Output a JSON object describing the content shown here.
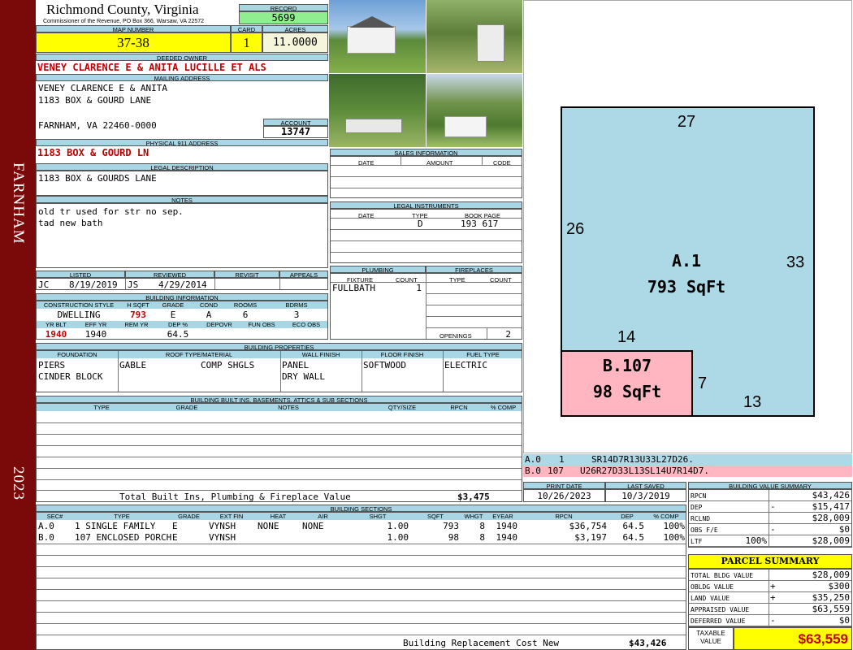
{
  "sidebar": {
    "district": "FARNHAM",
    "year": "2023"
  },
  "header": {
    "county": "Richmond County, Virginia",
    "commissioner": "Commissioner of the Revenue, PO Box 366, Warsaw, VA 22572",
    "record_label": "RECORD",
    "record": "5699",
    "map_label": "MAP NUMBER",
    "map_number": "37-38",
    "card_label": "CARD",
    "card": "1",
    "acres_label": "ACRES",
    "acres": "11.0000"
  },
  "owner": {
    "deeded_label": "DEEDED OWNER",
    "deeded": "VENEY CLARENCE E & ANITA LUCILLE ET ALS",
    "mailing_label": "MAILING ADDRESS",
    "mail1": "VENEY CLARENCE E & ANITA",
    "mail2": "1183 BOX & GOURD LANE",
    "mail3": "FARNHAM, VA 22460-0000",
    "account_label": "ACCOUNT",
    "account": "13747",
    "physical_label": "PHYSICAL 911 ADDRESS",
    "physical": "1183 BOX & GOURD LN",
    "legal_label": "LEGAL DESCRIPTION",
    "legal": "1183 BOX & GOURDS LANE",
    "notes_label": "NOTES",
    "note1": "old tr used for str no sep.",
    "note2": "tad new bath"
  },
  "sales": {
    "title": "SALES INFORMATION",
    "h_date": "DATE",
    "h_amount": "AMOUNT",
    "h_code": "CODE"
  },
  "instruments": {
    "title": "LEGAL INSTRUMENTS",
    "h_date": "DATE",
    "h_type": "TYPE",
    "h_book": "BOOK PAGE",
    "type": "D",
    "book": "193 617"
  },
  "listing": {
    "listed_label": "LISTED",
    "reviewed_label": "REVIEWED",
    "revisit_label": "REVISIT",
    "appeals_label": "APPEALS",
    "listed_by": "JC",
    "listed_date": "8/19/2019",
    "reviewed_by": "JS",
    "reviewed_date": "4/29/2014"
  },
  "plumbing": {
    "title": "PLUMBING",
    "h_fixture": "FIXTURE",
    "h_count": "COUNT",
    "fixture": "FULLBATH",
    "count": "1"
  },
  "fireplaces": {
    "title": "FIREPLACES",
    "h_type": "TYPE",
    "h_count": "COUNT",
    "openings_label": "OPENINGS",
    "openings": "2"
  },
  "building": {
    "title": "BUILDING INFORMATION",
    "h_style": "CONSTRUCTION STYLE",
    "h_hsqft": "H SQFT",
    "h_grade": "GRADE",
    "h_cond": "COND",
    "h_rooms": "ROOMS",
    "h_bdrms": "BDRMS",
    "style": "DWELLING",
    "hsqft": "793",
    "grade": "E",
    "cond": "A",
    "rooms": "6",
    "bdrms": "3",
    "h_yrblt": "YR BLT",
    "h_effyr": "EFF YR",
    "h_remyr": "REM YR",
    "h_dep": "DEP %",
    "h_depovr": "DEPOVR",
    "h_funobs": "FUN OBS",
    "h_ecoobs": "ECO OBS",
    "yrblt": "1940",
    "effyr": "1940",
    "dep": "64.5"
  },
  "properties": {
    "title": "BUILDING PROPERTIES",
    "h_found": "FOUNDATION",
    "h_roof": "ROOF TYPE/MATERIAL",
    "h_wall": "WALL FINISH",
    "h_floor": "FLOOR FINISH",
    "h_fuel": "FUEL TYPE",
    "found1": "PIERS",
    "found2": "CINDER BLOCK",
    "roof_type": "GABLE",
    "roof_mat": "COMP SHGLS",
    "wall1": "PANEL",
    "wall2": "DRY WALL",
    "floor": "SOFTWOOD",
    "fuel": "ELECTRIC"
  },
  "builtins": {
    "title": "BUILDING BUILT INS, BASEMENTS, ATTICS & SUB SECTIONS",
    "h_type": "TYPE",
    "h_grade": "GRADE",
    "h_notes": "NOTES",
    "h_qty": "QTY/SIZE",
    "h_rpcn": "RPCN",
    "h_comp": "% COMP",
    "total_label": "Total Built Ins, Plumbing & Fireplace Value",
    "total": "$3,475"
  },
  "sketch": {
    "a_label": "A.1",
    "a_area": "793 SqFt",
    "b_label": "B.107",
    "b_area": "98 SqFt",
    "d_top": "27",
    "d_left": "26",
    "d_right": "33",
    "d_mid": "14",
    "d_7": "7",
    "d_13": "13",
    "fill_a": "#add8e6",
    "fill_b": "#ffb6c1",
    "legend": [
      {
        "id": "A.0",
        "code": "1",
        "path": "SR14D7R13U33L27D26."
      },
      {
        "id": "B.0",
        "code": "107",
        "path": "U26R27D33L13SL14U7R14D7."
      }
    ]
  },
  "dates": {
    "print_label": "PRINT DATE",
    "print": "10/26/2023",
    "saved_label": "LAST SAVED",
    "saved": "10/3/2019"
  },
  "sections": {
    "title": "BUILDING SECTIONS",
    "headers": [
      "SEC#",
      "TYPE",
      "GRADE",
      "EXT FIN",
      "HEAT",
      "AIR",
      "SHGT",
      "SQFT",
      "WHGT",
      "EYEAR",
      "RPCN",
      "DEP",
      "% COMP"
    ],
    "rows": [
      [
        "A.0",
        "1 SINGLE FAMILY",
        "E",
        "VYNSH",
        "NONE",
        "NONE",
        "1.00",
        "793",
        "8",
        "1940",
        "$36,754",
        "64.5",
        "100%"
      ],
      [
        "B.0",
        "107 ENCLOSED PORCH",
        "E",
        "VYNSH",
        "",
        "",
        "1.00",
        "98",
        "8",
        "1940",
        "$3,197",
        "64.5",
        "100%"
      ]
    ],
    "replacement_label": "Building Replacement Cost New",
    "replacement": "$43,426"
  },
  "bvs": {
    "title": "BUILDING VALUE SUMMARY",
    "rows": [
      {
        "label": "RPCN",
        "sign": "",
        "value": "$43,426"
      },
      {
        "label": "DEP",
        "sign": "-",
        "value": "$15,417"
      },
      {
        "label": "RCLND",
        "sign": "",
        "value": "$28,009"
      },
      {
        "label": "OBS F/E",
        "sign": "-",
        "value": "$0"
      },
      {
        "label": "LTF",
        "sign": "100%",
        "value": "$28,009"
      }
    ]
  },
  "parcel": {
    "title": "PARCEL SUMMARY",
    "rows": [
      {
        "label": "TOTAL BLDG VALUE",
        "sign": "",
        "value": "$28,009"
      },
      {
        "label": "OBLDG VALUE",
        "sign": "+",
        "value": "$300"
      },
      {
        "label": "LAND VALUE",
        "sign": "+",
        "value": "$35,250"
      },
      {
        "label": "APPRAISED VALUE",
        "sign": "",
        "value": "$63,559"
      },
      {
        "label": "DEFERRED VALUE",
        "sign": "-",
        "value": "$0"
      }
    ],
    "taxable_label1": "TAXABLE",
    "taxable_label2": "VALUE",
    "taxable": "$63,559"
  }
}
